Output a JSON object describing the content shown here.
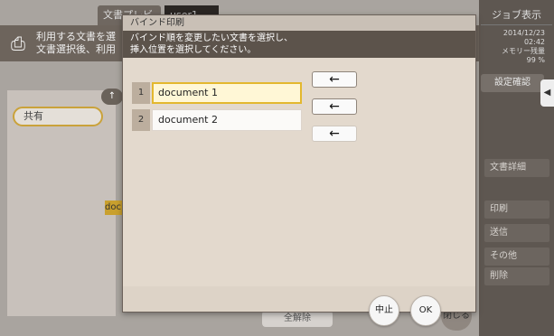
{
  "background": {
    "tab_preview": "文書プレビュー",
    "tab_user": "user1",
    "header_text": "利用する文書を選\n文書選択後、利用",
    "folder_label": "共有",
    "doc_label": "doc",
    "job_display": "ジョブ表示",
    "status": {
      "date": "2014/12/23",
      "time": "02:42",
      "memory_label": "メモリー残量",
      "memory_value": "99 %"
    },
    "confirm_settings": "設定確認",
    "side_menu": [
      "文書詳細",
      "印刷",
      "送信",
      "その他",
      "削除"
    ],
    "clear_all": "全解除",
    "close": "閉じる"
  },
  "dialog": {
    "title": "バインド印刷",
    "message_line1": "バインド順を変更したい文書を選択し、",
    "message_line2": "挿入位置を選択してください。",
    "documents": [
      {
        "num": "1",
        "name": "document 1"
      },
      {
        "num": "2",
        "name": "document 2"
      }
    ],
    "arrow_glyph": "←",
    "cancel_label": "中止",
    "ok_label": "OK"
  }
}
